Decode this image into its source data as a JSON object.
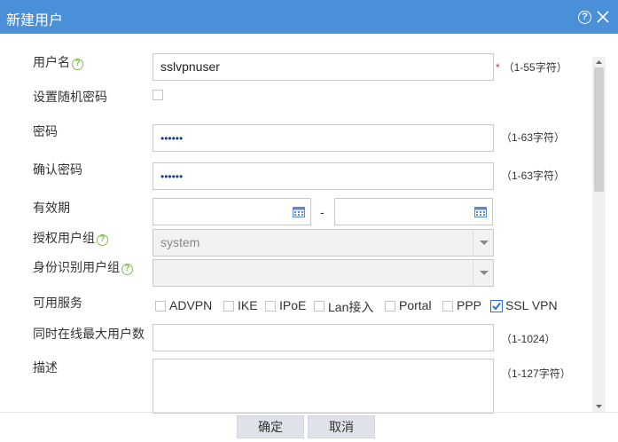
{
  "dialog": {
    "title": "新建用户",
    "help_glyph": "?"
  },
  "fields": {
    "username": {
      "label": "用户名",
      "value": "sslvpnuser",
      "required_mark": "*",
      "hint": "（1-55字符）"
    },
    "random_password": {
      "label": "设置随机密码",
      "checked": false
    },
    "password": {
      "label": "密码",
      "value": "••••••",
      "hint": "（1-63字符）"
    },
    "confirm_password": {
      "label": "确认密码",
      "value": "••••••",
      "hint": "（1-63字符）"
    },
    "validity": {
      "label": "有效期",
      "start": "",
      "end": "",
      "separator": "-"
    },
    "authorized_group": {
      "label": "授权用户组",
      "value": "system"
    },
    "identity_group": {
      "label": "身份识别用户组",
      "value": ""
    },
    "services": {
      "label": "可用服务",
      "items": [
        {
          "label": "ADVPN",
          "checked": false
        },
        {
          "label": "IKE",
          "checked": false
        },
        {
          "label": "IPoE",
          "checked": false
        },
        {
          "label": "Lan接入",
          "checked": false
        },
        {
          "label": "Portal",
          "checked": false
        },
        {
          "label": "PPP",
          "checked": false
        },
        {
          "label": "SSL VPN",
          "checked": true
        }
      ]
    },
    "max_online": {
      "label": "同时在线最大用户数",
      "value": "",
      "hint": "（1-1024）"
    },
    "description": {
      "label": "描述",
      "value": "",
      "hint": "（1-127字符）"
    }
  },
  "footer": {
    "ok_label": "确定",
    "cancel_label": "取消"
  },
  "colors": {
    "titlebar": "#4a90d9",
    "help_icon": "#7cc243",
    "required": "#e22222",
    "checkbox_checked": "#2f6fd0"
  }
}
